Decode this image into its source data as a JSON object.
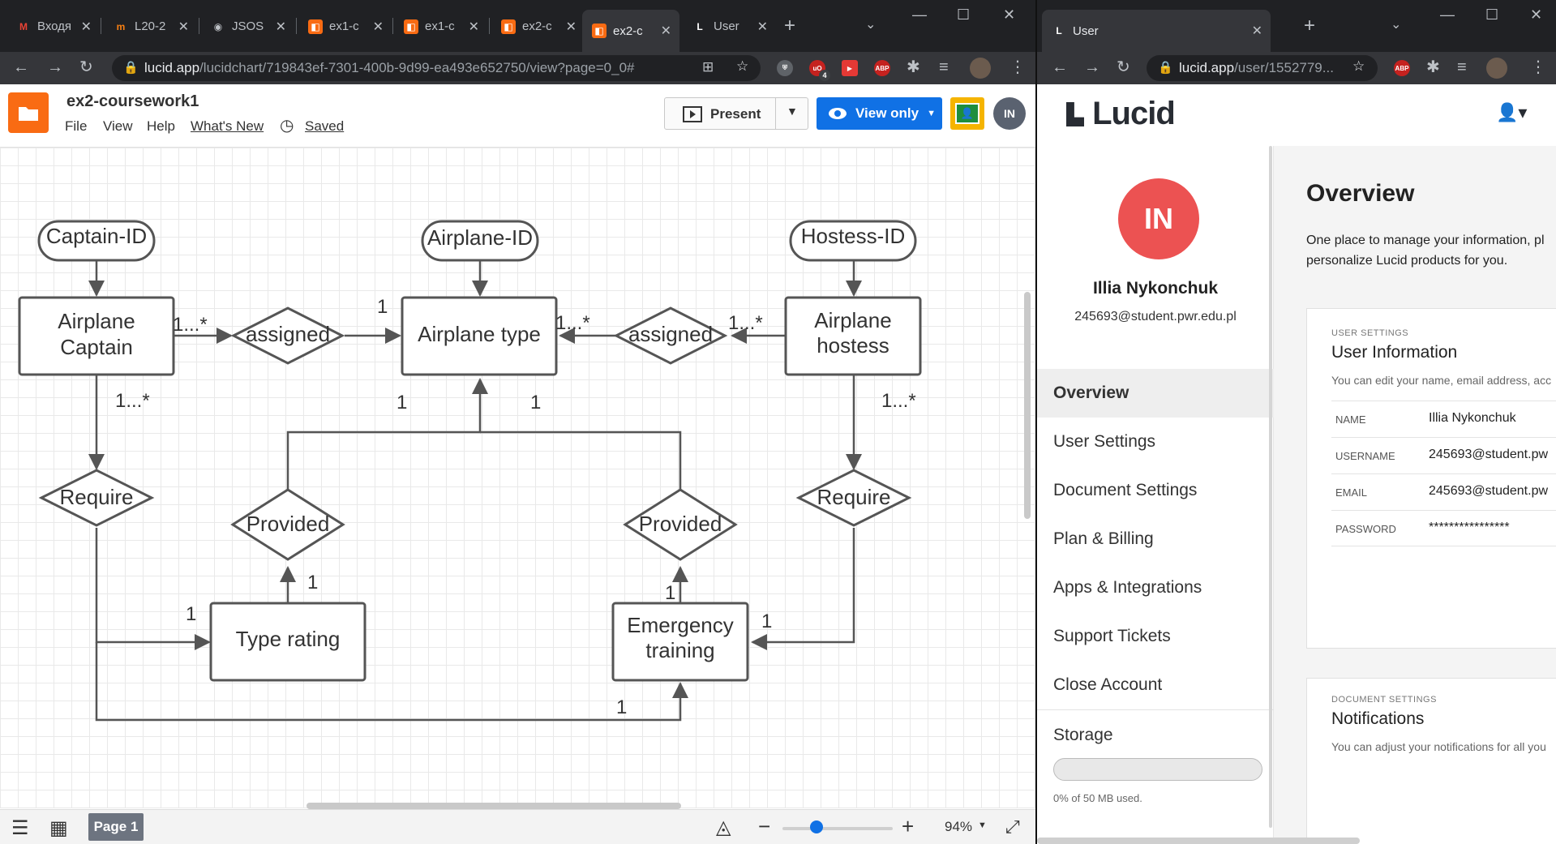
{
  "left_browser": {
    "tabs": [
      {
        "label": "Входя",
        "icon": "gmail-icon"
      },
      {
        "label": "L20-2",
        "icon": "moodle-icon"
      },
      {
        "label": "JSOS",
        "icon": "jsos-icon"
      },
      {
        "label": "ex1-c",
        "icon": "lucidchart-icon"
      },
      {
        "label": "ex1-c",
        "icon": "lucidchart-icon"
      },
      {
        "label": "ex2-c",
        "icon": "lucidchart-icon"
      },
      {
        "label": "ex2-c",
        "icon": "lucidchart-icon",
        "active": true
      },
      {
        "label": "User",
        "icon": "lucid-icon"
      }
    ],
    "url_host": "lucid.app",
    "url_path": "/lucidchart/719843ef-7301-400b-9d99-ea493e652750/view?page=0_0#",
    "ext_badge": "4",
    "ext_abp": "ABP"
  },
  "lucidchart": {
    "doc_title": "ex2-coursework1",
    "menu": [
      "File",
      "View",
      "Help",
      "What's New"
    ],
    "saved_label": "Saved",
    "present_label": "Present",
    "view_only_label": "View only",
    "user_initials": "IN",
    "page_tab": "Page 1",
    "zoom": "94%",
    "zoom_level": 0.31
  },
  "diagram": {
    "attributes": [
      "Captain-ID",
      "Airplane-ID",
      "Hostess-ID"
    ],
    "entities": [
      "Airplane\nCaptain",
      "Airplane type",
      "Airplane\nhostess",
      "Type rating",
      "Emergency\ntraining"
    ],
    "relationships": [
      "assigned",
      "assigned",
      "Require",
      "Provided",
      "Provided",
      "Require"
    ],
    "cardinalities": {
      "captain_assigned": "1...*",
      "assigned_type_left": "1",
      "type_assigned_right": "1...*",
      "assigned_hostess": "1...*",
      "captain_require": "1...*",
      "type_provided_left": "1",
      "type_provided_right": "1",
      "hostess_require": "1...*",
      "provided_typerating": "1",
      "require_typerating": "1",
      "provided_emergency": "1",
      "require_emergency": "1",
      "captain_emergency": "1"
    }
  },
  "right_browser": {
    "tab_label": "User",
    "url_host": "lucid.app",
    "url_path": "/user/1552779...",
    "ext_abp": "ABP"
  },
  "account": {
    "logo": "Lucid",
    "user_initials": "IN",
    "user_name": "Illia Nykonchuk",
    "user_email": "245693@student.pwr.edu.pl",
    "nav": [
      "Overview",
      "User Settings",
      "Document Settings",
      "Plan & Billing",
      "Apps & Integrations",
      "Support Tickets",
      "Close Account"
    ],
    "storage_label": "Storage",
    "storage_used": "0% of 50 MB used.",
    "storage_fraction": 0,
    "overview_title": "Overview",
    "overview_desc_1": "One place to manage your information, pl",
    "overview_desc_2": "personalize Lucid products for you.",
    "user_settings": {
      "eyebrow": "USER SETTINGS",
      "title": "User Information",
      "desc": "You can edit your name, email address, acc",
      "rows": [
        {
          "key": "NAME",
          "value": "Illia Nykonchuk"
        },
        {
          "key": "USERNAME",
          "value": "245693@student.pw"
        },
        {
          "key": "EMAIL",
          "value": "245693@student.pw"
        },
        {
          "key": "PASSWORD",
          "value": "****************"
        }
      ]
    },
    "document_settings": {
      "eyebrow": "DOCUMENT SETTINGS",
      "title": "Notifications",
      "desc": "You can adjust your notifications for all you"
    }
  }
}
